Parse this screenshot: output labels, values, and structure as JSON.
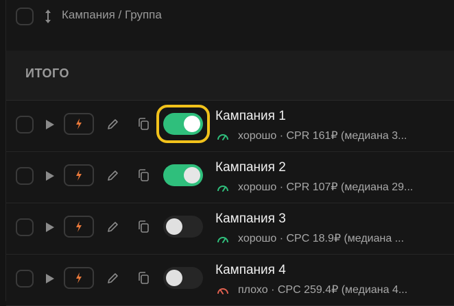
{
  "header": {
    "column_label": "Кампания / Группа"
  },
  "total": {
    "label": "ИТОГО"
  },
  "colors": {
    "toggle_on": "#2fbf7c",
    "toggle_off": "#262626",
    "status_good": "#2fbf7c",
    "status_bad": "#e0604f",
    "bolt": "#e8783a",
    "highlight": "#f2c21b"
  },
  "icons": {
    "sort": "sort-arrows-icon",
    "play": "play-icon",
    "bolt": "lightning-icon",
    "edit": "pencil-icon",
    "copy": "copy-icon",
    "gauge": "gauge-icon"
  },
  "rows": [
    {
      "name": "Кампания 1",
      "status": "good",
      "active": true,
      "metric": "хорошо · CPR 161₽ (медиана 3..."
    },
    {
      "name": "Кампания 2",
      "status": "good",
      "active": true,
      "metric": "хорошо · CPR 107₽ (медиана 29..."
    },
    {
      "name": "Кампания 3",
      "status": "good",
      "active": false,
      "metric": "хорошо · CPC 18.9₽ (медиана ..."
    },
    {
      "name": "Кампания 4",
      "status": "bad",
      "active": false,
      "metric": "плохо · CPC 259.4₽ (медиана 4..."
    }
  ]
}
